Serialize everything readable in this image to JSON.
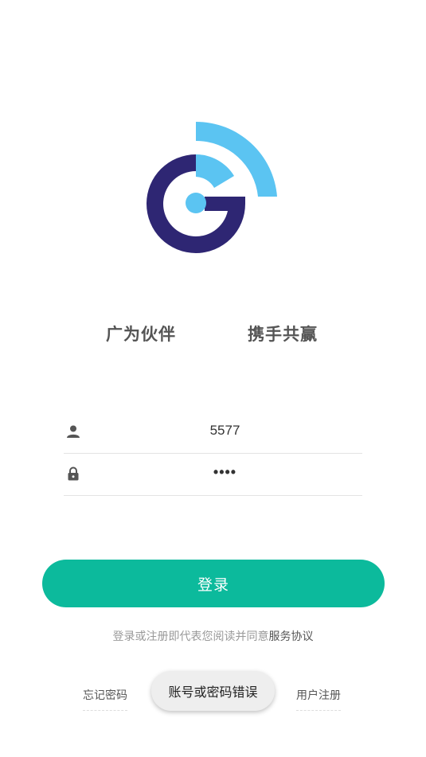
{
  "logo": {
    "icon": "brand-logo-icon",
    "colors": {
      "dark": "#2e2673",
      "light": "#5bc4f2"
    }
  },
  "slogan": {
    "left": "广为伙伴",
    "right": "携手共赢"
  },
  "form": {
    "username": {
      "icon": "person-icon",
      "value": "5577"
    },
    "password": {
      "icon": "lock-icon",
      "value": "••••"
    }
  },
  "login_button": {
    "label": "登录",
    "color": "#0cba9c"
  },
  "agreement": {
    "prefix": "登录或注册即代表您阅读并同意",
    "link": "服务协议"
  },
  "links": {
    "forgot": "忘记密码",
    "register": "用户注册"
  },
  "toast": {
    "message": "账号或密码错误"
  }
}
